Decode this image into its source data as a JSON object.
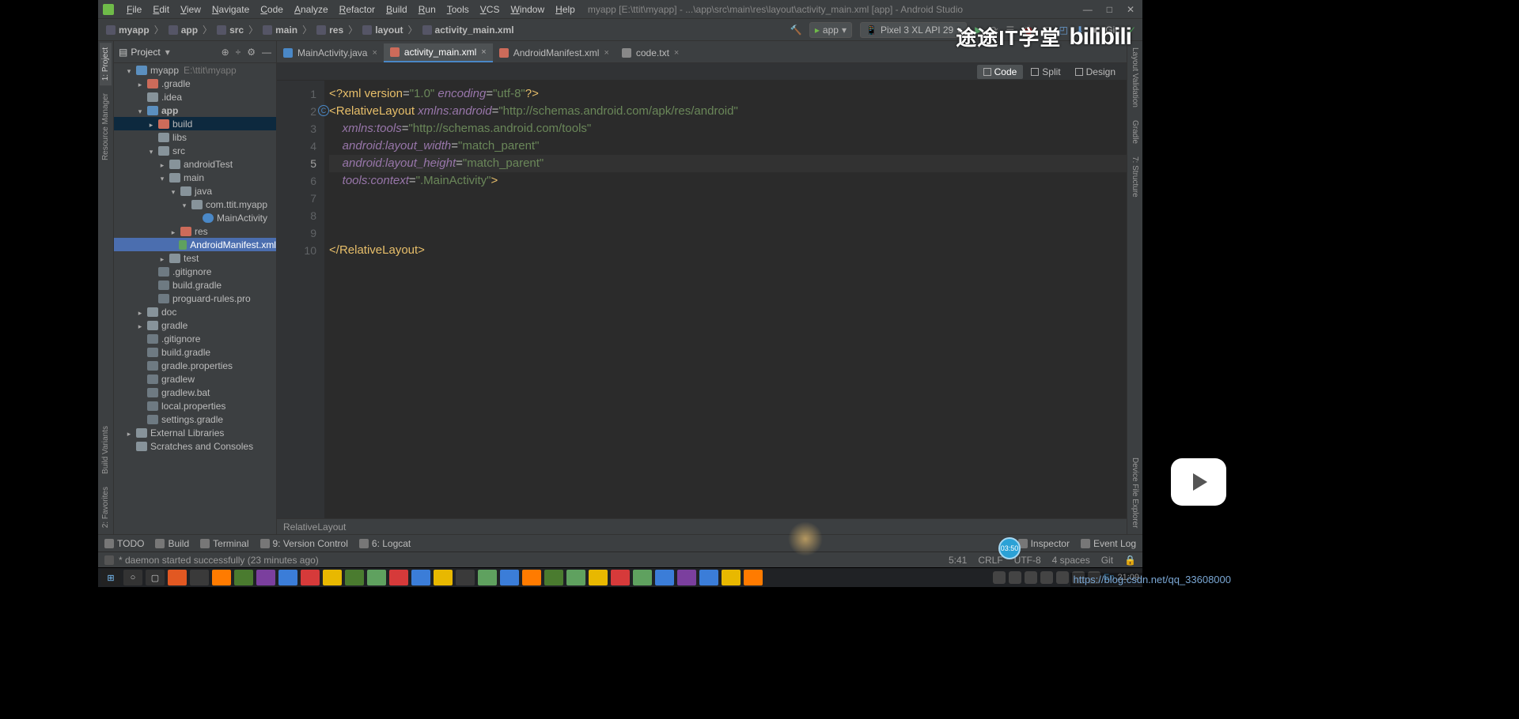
{
  "menubar": [
    "File",
    "Edit",
    "View",
    "Navigate",
    "Code",
    "Analyze",
    "Refactor",
    "Build",
    "Run",
    "Tools",
    "VCS",
    "Window",
    "Help"
  ],
  "window_title": "myapp [E:\\ttit\\myapp] - ...\\app\\src\\main\\res\\layout\\activity_main.xml [app] - Android Studio",
  "breadcrumbs": [
    "myapp",
    "app",
    "src",
    "main",
    "res",
    "layout",
    "activity_main.xml"
  ],
  "run_config": "app",
  "device": "Pixel 3 XL API 29",
  "git_label": "Git:",
  "project_label": "Project",
  "tree": {
    "root": "myapp",
    "root_path": "E:\\ttit\\myapp",
    "items": [
      {
        "d": 1,
        "arrow": "open",
        "ic": "mod",
        "label": "myapp",
        "path": "E:\\ttit\\myapp"
      },
      {
        "d": 2,
        "arrow": "closed",
        "ic": "fold-red",
        "label": ".gradle"
      },
      {
        "d": 2,
        "arrow": "",
        "ic": "fold",
        "label": ".idea"
      },
      {
        "d": 2,
        "arrow": "open",
        "ic": "mod",
        "label": "app",
        "bold": true
      },
      {
        "d": 3,
        "arrow": "closed",
        "ic": "fold-red",
        "label": "build",
        "hl": true
      },
      {
        "d": 3,
        "arrow": "",
        "ic": "fold",
        "label": "libs"
      },
      {
        "d": 3,
        "arrow": "open",
        "ic": "fold",
        "label": "src"
      },
      {
        "d": 4,
        "arrow": "closed",
        "ic": "fold",
        "label": "androidTest"
      },
      {
        "d": 4,
        "arrow": "open",
        "ic": "fold",
        "label": "main"
      },
      {
        "d": 5,
        "arrow": "open",
        "ic": "fold",
        "label": "java"
      },
      {
        "d": 6,
        "arrow": "open",
        "ic": "fold",
        "label": "com.ttit.myapp"
      },
      {
        "d": 7,
        "arrow": "",
        "ic": "class",
        "label": "MainActivity"
      },
      {
        "d": 5,
        "arrow": "closed",
        "ic": "fold-red",
        "label": "res"
      },
      {
        "d": 5,
        "arrow": "",
        "ic": "xml",
        "label": "AndroidManifest.xml",
        "sel": true
      },
      {
        "d": 4,
        "arrow": "closed",
        "ic": "fold",
        "label": "test"
      },
      {
        "d": 3,
        "arrow": "",
        "ic": "file",
        "label": ".gitignore"
      },
      {
        "d": 3,
        "arrow": "",
        "ic": "file",
        "label": "build.gradle"
      },
      {
        "d": 3,
        "arrow": "",
        "ic": "file",
        "label": "proguard-rules.pro"
      },
      {
        "d": 2,
        "arrow": "closed",
        "ic": "fold",
        "label": "doc"
      },
      {
        "d": 2,
        "arrow": "closed",
        "ic": "fold",
        "label": "gradle"
      },
      {
        "d": 2,
        "arrow": "",
        "ic": "file",
        "label": ".gitignore"
      },
      {
        "d": 2,
        "arrow": "",
        "ic": "file",
        "label": "build.gradle"
      },
      {
        "d": 2,
        "arrow": "",
        "ic": "file",
        "label": "gradle.properties"
      },
      {
        "d": 2,
        "arrow": "",
        "ic": "file",
        "label": "gradlew"
      },
      {
        "d": 2,
        "arrow": "",
        "ic": "file",
        "label": "gradlew.bat"
      },
      {
        "d": 2,
        "arrow": "",
        "ic": "file",
        "label": "local.properties"
      },
      {
        "d": 2,
        "arrow": "",
        "ic": "file",
        "label": "settings.gradle"
      },
      {
        "d": 1,
        "arrow": "closed",
        "ic": "fold",
        "label": "External Libraries"
      },
      {
        "d": 1,
        "arrow": "",
        "ic": "fold",
        "label": "Scratches and Consoles"
      }
    ]
  },
  "tabs": [
    {
      "label": "MainActivity.java",
      "ic": "j"
    },
    {
      "label": "activity_main.xml",
      "ic": "x",
      "active": true
    },
    {
      "label": "AndroidManifest.xml",
      "ic": "x"
    },
    {
      "label": "code.txt",
      "ic": "t"
    }
  ],
  "viewmodes": {
    "code": "Code",
    "split": "Split",
    "design": "Design"
  },
  "code_lines": [
    {
      "n": 1,
      "html": "<span class='tok-br'>&lt;?</span><span class='tok-tag'>xml version</span><span class='tok-attr'>=</span><span class='tok-str'>\"1.0\"</span> <span class='tok-attr-ns'>encoding</span><span class='tok-attr'>=</span><span class='tok-str'>\"utf-8\"</span><span class='tok-br'>?&gt;</span>"
    },
    {
      "n": 2,
      "marker": "C",
      "html": "<span class='tok-br'>&lt;</span><span class='tok-tag'>RelativeLayout </span><span class='tok-attr-ns'>xmlns:android</span><span class='tok-attr'>=</span><span class='tok-str'>\"http://schemas.android.com/apk/res/android\"</span>"
    },
    {
      "n": 3,
      "html": "    <span class='tok-attr-ns'>xmlns:tools</span><span class='tok-attr'>=</span><span class='tok-str'>\"http://schemas.android.com/tools\"</span>"
    },
    {
      "n": 4,
      "html": "    <span class='tok-attr-ns'>android:layout_width</span><span class='tok-attr'>=</span><span class='tok-str'>\"match_parent\"</span>"
    },
    {
      "n": 5,
      "cur": true,
      "html": "    <span class='tok-attr-ns'>android:layout_height</span><span class='tok-attr'>=</span><span class='tok-str'>\"match_parent\"</span>"
    },
    {
      "n": 6,
      "html": "    <span class='tok-attr-ns'>tools:context</span><span class='tok-attr'>=</span><span class='tok-str'>\".MainActivity\"</span><span class='tok-br'>&gt;</span>"
    },
    {
      "n": 7,
      "html": ""
    },
    {
      "n": 8,
      "html": ""
    },
    {
      "n": 9,
      "html": ""
    },
    {
      "n": 10,
      "html": "<span class='tok-br'>&lt;/</span><span class='tok-tag'>RelativeLayout</span><span class='tok-br'>&gt;</span>"
    }
  ],
  "breadcrumb_bottom": "RelativeLayout",
  "bottom_tools": [
    "TODO",
    "Build",
    "Terminal",
    "9: Version Control",
    "6: Logcat"
  ],
  "bottom_right": [
    "Inspector",
    "Event Log"
  ],
  "status_msg": "* daemon started successfully (23 minutes ago)",
  "status_right": [
    "5:41",
    "CRLF",
    "UTF-8",
    "4 spaces",
    "Git"
  ],
  "left_rails": [
    "1: Project",
    "Resource Manager",
    "Build Variants",
    "2: Favorites"
  ],
  "right_rails": [
    "Layout Validation",
    "Gradle",
    "7: Structure",
    "Device File Explorer"
  ],
  "taskbar_time": "21:09",
  "url_overlay": "https://blog.csdn.net/qq_33608000",
  "watermark": {
    "ch": "途途IT学堂",
    "bili": "bilibili"
  },
  "badge_time": "03:50"
}
